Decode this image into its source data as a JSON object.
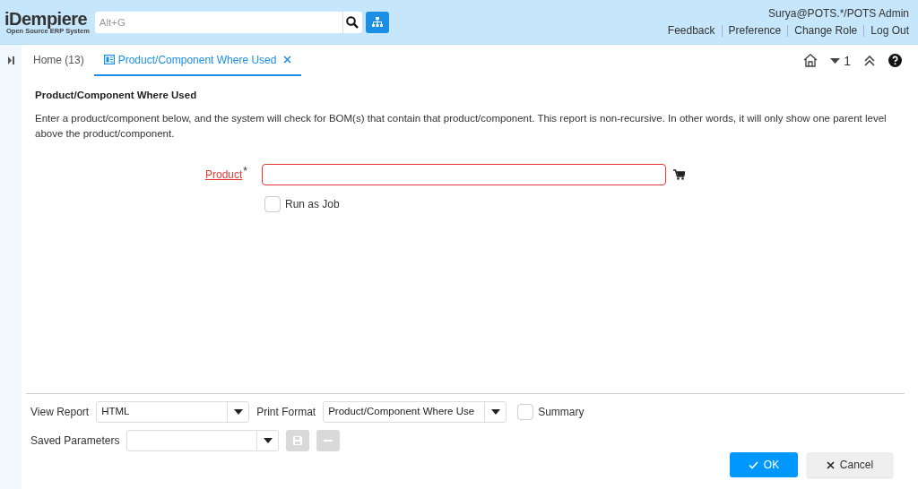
{
  "header": {
    "logo": {
      "name": "iDempiere",
      "tagline": "Open Source ERP System"
    },
    "search": {
      "placeholder": "Alt+G"
    },
    "user": "Surya@POTS.*/POTS Admin",
    "links": [
      "Feedback",
      "Preference",
      "Change Role",
      "Log Out"
    ]
  },
  "tabs": [
    {
      "label": "Home (13)",
      "selected": false,
      "closable": false
    },
    {
      "label": "Product/Component Where Used",
      "selected": true,
      "closable": true
    }
  ],
  "toolbar": {
    "window_count": "1"
  },
  "form": {
    "title": "Product/Component Where Used",
    "description": "Enter a product/component below, and the system will check for BOM(s) that contain that product/component. This report is non-recursive. In other words, it will only show one parent level above the product/component.",
    "fields": [
      {
        "kind": "search",
        "label": "Product",
        "required": true,
        "required_mark": "*"
      },
      {
        "kind": "checkbox",
        "label": "Run as Job",
        "checked": false
      }
    ]
  },
  "report": {
    "view_report": {
      "label": "View Report",
      "value": "HTML"
    },
    "print_format": {
      "label": "Print Format",
      "value": "Product/Component Where Use"
    },
    "summary": {
      "label": "Summary",
      "checked": false
    },
    "saved_parameters": {
      "label": "Saved Parameters"
    }
  },
  "buttons": [
    {
      "kind": "ok",
      "label": "OK"
    },
    {
      "kind": "cancel",
      "label": "Cancel"
    }
  ]
}
